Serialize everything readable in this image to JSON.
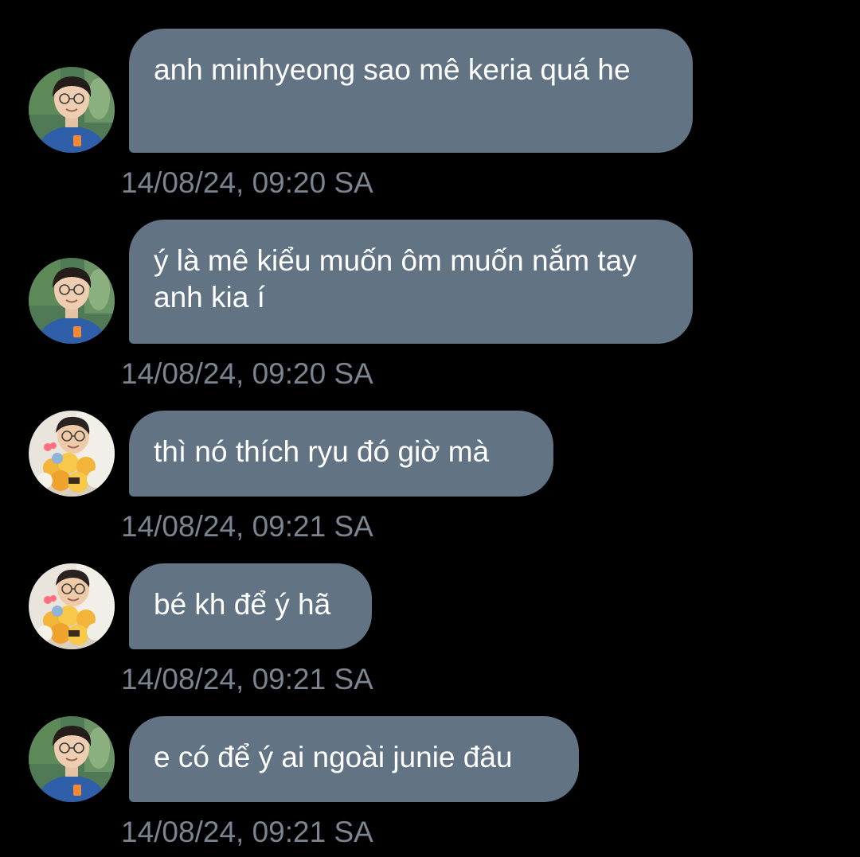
{
  "messages": [
    {
      "sender_avatar": "avatar-boy-glasses-blue-shirt",
      "text": "anh minhyeong sao mê keria quá he",
      "timestamp": "14/08/24, 09:20 SA"
    },
    {
      "sender_avatar": "avatar-boy-glasses-blue-shirt",
      "text": "ý là mê kiểu muốn ôm muốn nắm tay anh kia í",
      "timestamp": "14/08/24, 09:20 SA"
    },
    {
      "sender_avatar": "avatar-boy-with-yellow-flowers",
      "text": "thì nó thích ryu đó giờ mà",
      "timestamp": "14/08/24, 09:21 SA"
    },
    {
      "sender_avatar": "avatar-boy-with-yellow-flowers",
      "text": "bé kh để ý hã",
      "timestamp": "14/08/24, 09:21 SA"
    },
    {
      "sender_avatar": "avatar-boy-glasses-blue-shirt",
      "text": "e có để ý ai ngoài junie đâu",
      "timestamp": "14/08/24, 09:21 SA"
    }
  ],
  "colors": {
    "background": "#000000",
    "bubble": "#627384",
    "bubble_text": "#ffffff",
    "timestamp": "#7b8591"
  }
}
